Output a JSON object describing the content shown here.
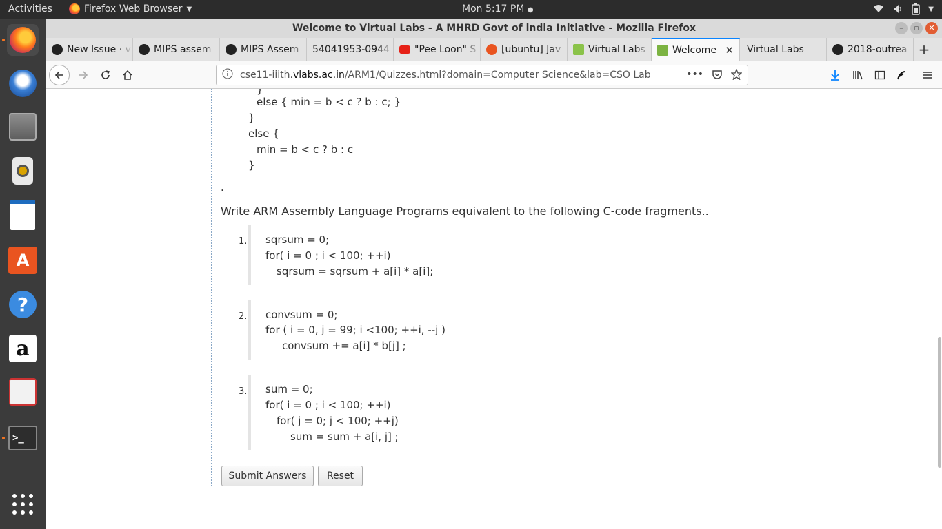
{
  "topbar": {
    "activities": "Activities",
    "app_name": "Firefox Web Browser",
    "clock": "Mon  5:17 PM"
  },
  "dock": {
    "items": [
      "firefox-icon",
      "thunderbird-icon",
      "files-icon",
      "rhythmbox-icon",
      "writer-icon",
      "software-center-icon",
      "help-icon",
      "amazon-icon",
      "document-viewer-icon",
      "terminal-icon",
      "app-grid-icon"
    ]
  },
  "window": {
    "title": "Welcome to Virtual Labs - A MHRD Govt of india Initiative - Mozilla Firefox"
  },
  "tabs": [
    {
      "label": "New Issue · v",
      "icon": "github-icon"
    },
    {
      "label": "MIPS assem",
      "icon": "github-icon"
    },
    {
      "label": "MIPS Assem",
      "icon": "github-icon"
    },
    {
      "label": "54041953-0944",
      "icon": "none"
    },
    {
      "label": "\"Pee Loon\" S",
      "icon": "youtube-icon"
    },
    {
      "label": "[ubuntu] Jav",
      "icon": "ubuntu-icon"
    },
    {
      "label": "Virtual Labs",
      "icon": "flask-icon"
    },
    {
      "label": "Welcome",
      "icon": "vlabs-icon",
      "active": true
    },
    {
      "label": "Virtual Labs",
      "icon": "none"
    },
    {
      "label": "2018-outrea",
      "icon": "github-icon"
    }
  ],
  "navbar": {
    "url_host": "cse11-iiith.vlabs.ac.in",
    "url_prefix": "",
    "url_path": "/ARM1/Quizzes.html?domain=Computer Science&lab=CSO Lab",
    "url_host_short": "cse11-iiith.",
    "url_host_bold": "vlabs.ac.in"
  },
  "page": {
    "code_top": [
      "}",
      "else { min = b < c ? b : c; }",
      "}",
      "else {",
      "min = b < c ? b : c",
      "}"
    ],
    "dot": ".",
    "instruction": "Write ARM Assembly Language Programs equivalent to the following C-code fragments..",
    "questions": [
      {
        "num": "1.",
        "lines": [
          "sqrsum = 0;",
          "for( i = 0 ; i < 100; ++i)",
          "sqrsum = sqrsum + a[i] * a[i];"
        ]
      },
      {
        "num": "2.",
        "lines": [
          "convsum = 0;",
          "for ( i = 0, j = 99; i <100; ++i, --j )",
          "convsum += a[i] * b[j] ;"
        ]
      },
      {
        "num": "3.",
        "lines": [
          "sum = 0;",
          "for( i = 0 ; i < 100; ++i)",
          "for( j = 0; j < 100; ++j)",
          "sum = sum + a[i, j] ;"
        ]
      }
    ],
    "submit_label": "Submit Answers",
    "reset_label": "Reset"
  },
  "colors": {
    "accent": "#0a84ff",
    "dock_bg": "#3b3b3b",
    "topbar_bg": "#2c2c2c",
    "close_btn": "#e25d33"
  }
}
